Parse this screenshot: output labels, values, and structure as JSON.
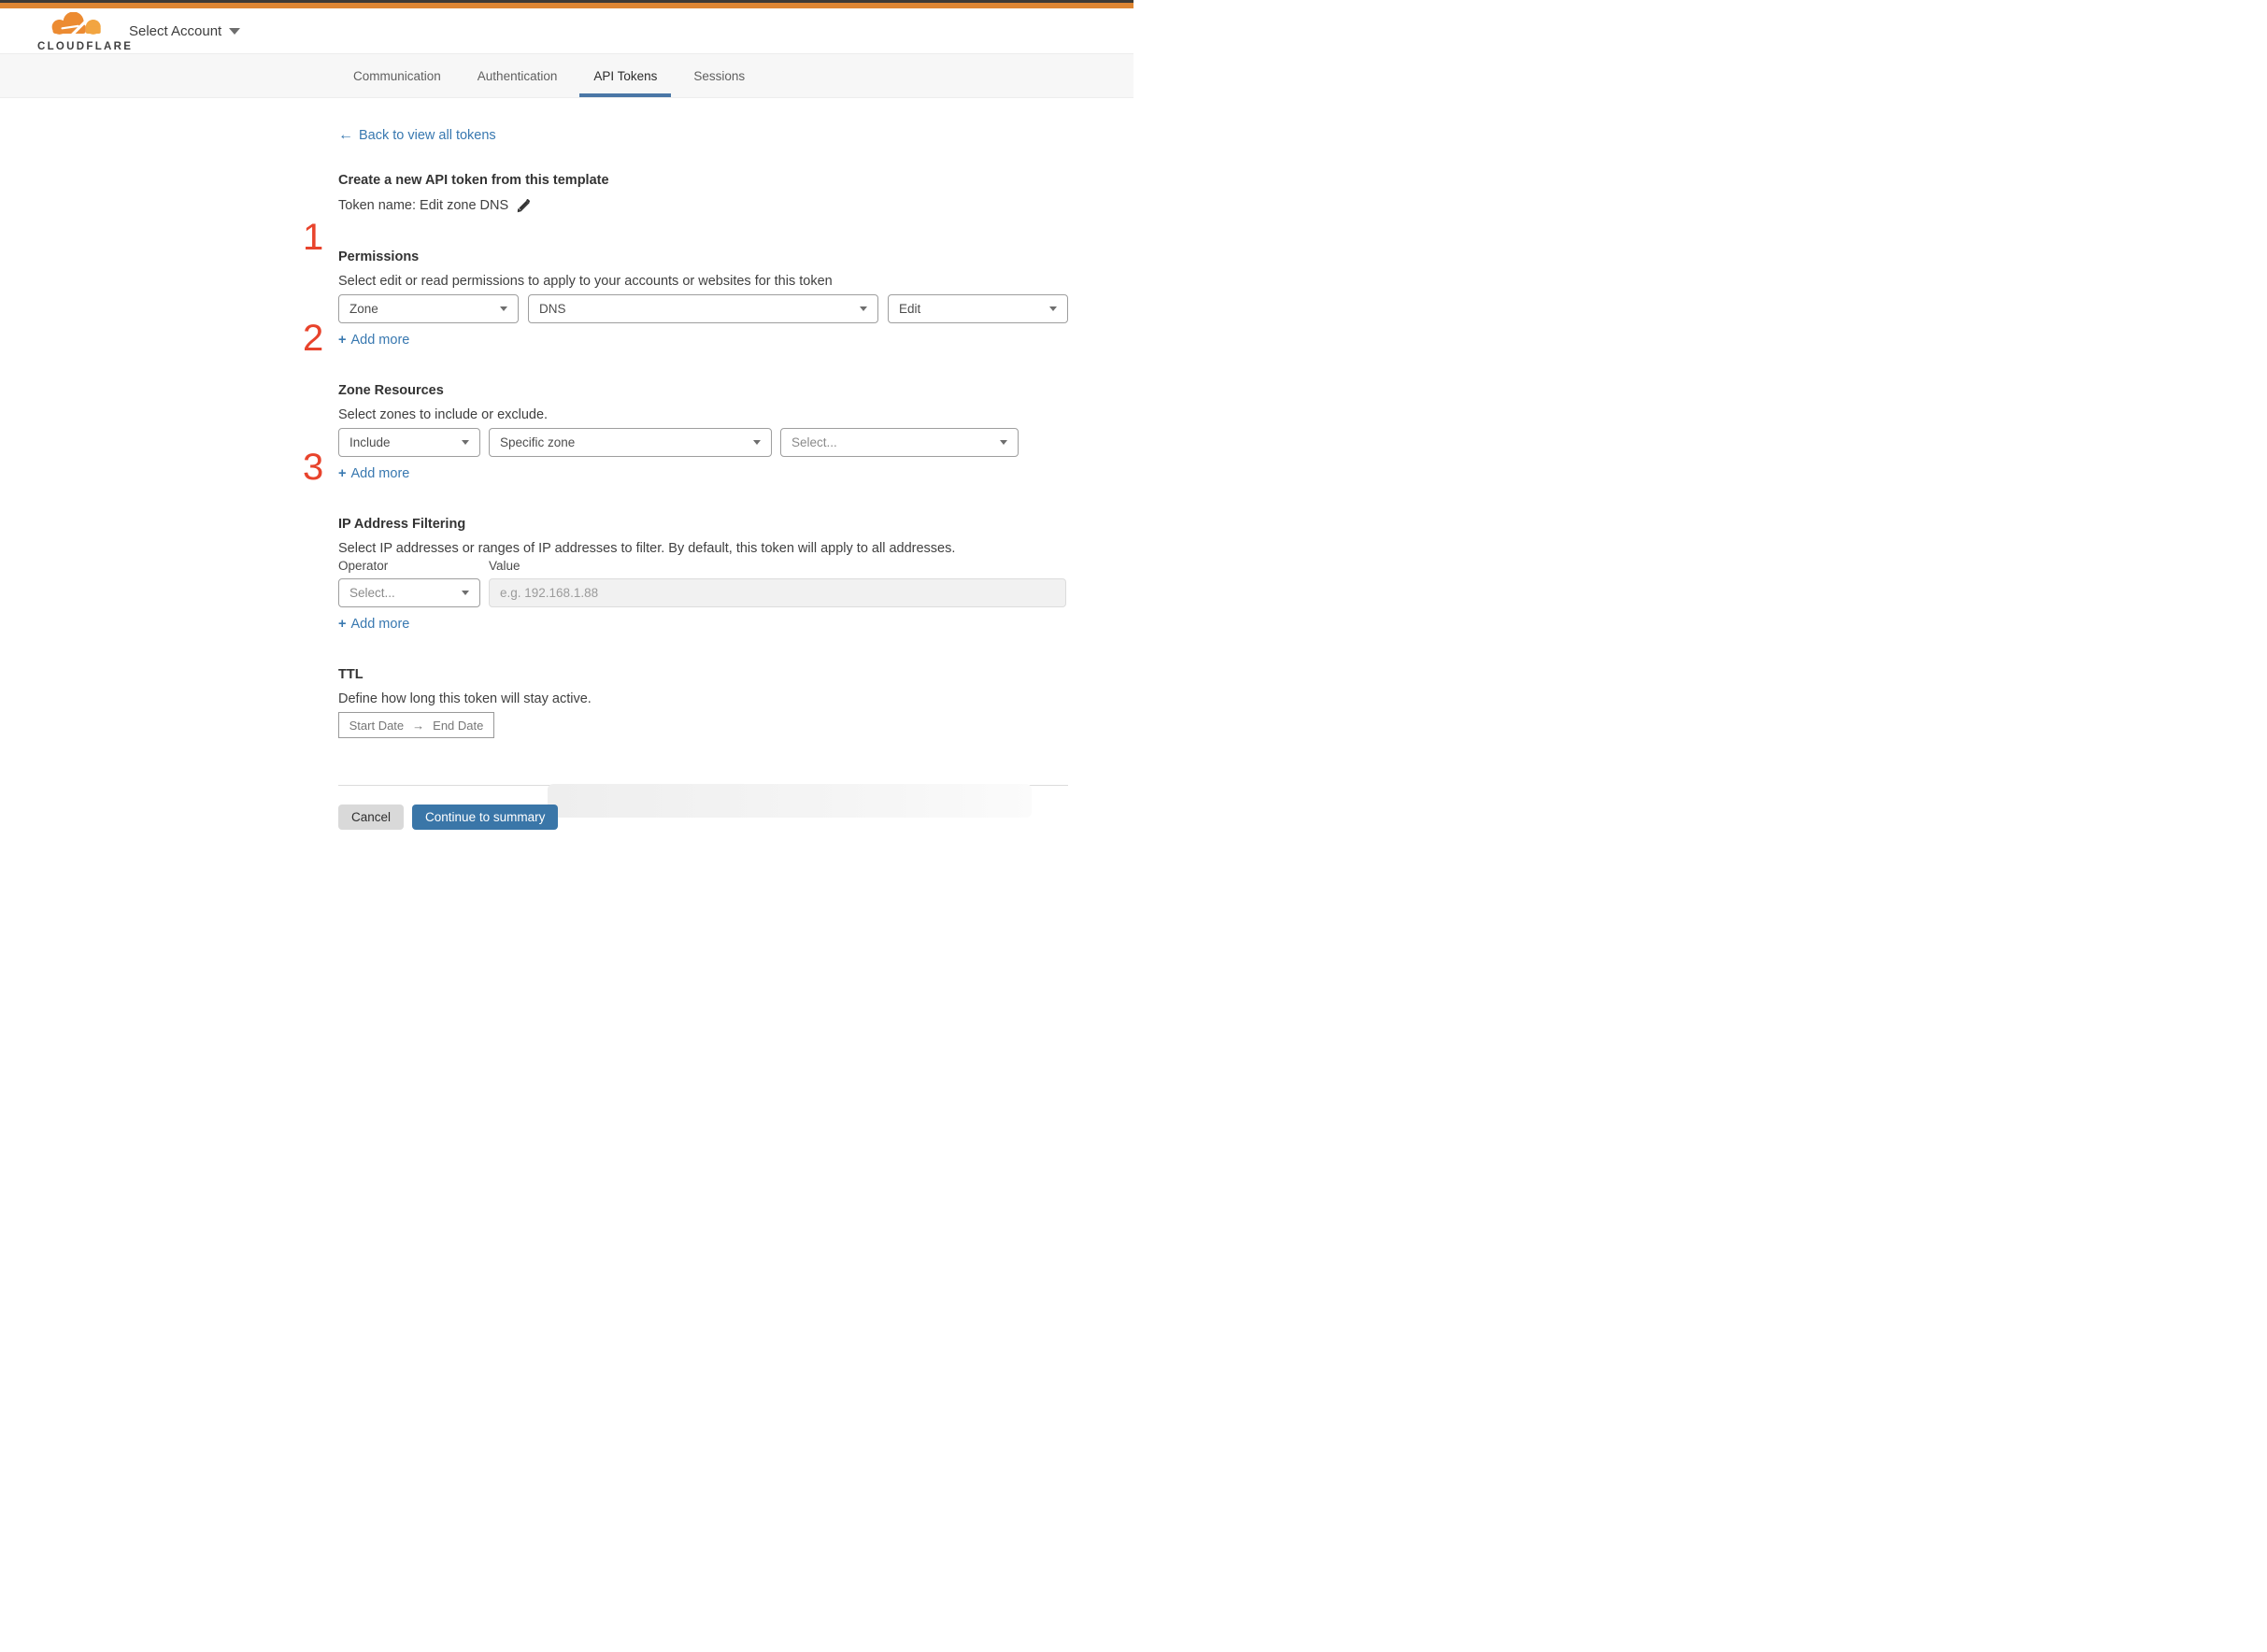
{
  "header": {
    "brand": "CLOUDFLARE",
    "account_selector": "Select Account"
  },
  "tabs": {
    "items": [
      {
        "label": "Communication",
        "active": false
      },
      {
        "label": "Authentication",
        "active": false
      },
      {
        "label": "API Tokens",
        "active": true
      },
      {
        "label": "Sessions",
        "active": false
      }
    ]
  },
  "page": {
    "back_link": {
      "arrow": "←",
      "label": "Back to view all tokens"
    },
    "title": "Create a new API token from this template",
    "token_name": "Token name: Edit zone DNS",
    "annotations": {
      "step1": "1",
      "step2": "2",
      "step3": "3"
    },
    "add_more": {
      "plus": "+",
      "label": "Add more"
    },
    "permissions": {
      "heading": "Permissions",
      "description": "Select edit or read permissions to apply to your accounts or websites for this token",
      "selects": [
        {
          "value": "Zone"
        },
        {
          "value": "DNS"
        },
        {
          "value": "Edit"
        }
      ]
    },
    "zone_resources": {
      "heading": "Zone Resources",
      "description": "Select zones to include or exclude.",
      "selects": [
        {
          "value": "Include"
        },
        {
          "value": "Specific zone"
        },
        {
          "value": "Select..."
        }
      ]
    },
    "ip_filtering": {
      "heading": "IP Address Filtering",
      "description": "Select IP addresses or ranges of IP addresses to filter. By default, this token will apply to all addresses.",
      "operator_label": "Operator",
      "value_label": "Value",
      "operator_value": "Select...",
      "value_placeholder": "e.g. 192.168.1.88"
    },
    "ttl": {
      "heading": "TTL",
      "description": "Define how long this token will stay active.",
      "start_date": "Start Date",
      "arrow": "→",
      "end_date": "End Date"
    },
    "footer": {
      "cancel": "Cancel",
      "continue": "Continue to summary"
    }
  },
  "colors": {
    "topbar_orange": "#de8633",
    "topbar_dark": "#3e3a35",
    "link_blue": "#3878b0",
    "tab_underline_blue": "#4a77a6",
    "continue_button_blue": "#3a76a8",
    "annotation_red": "#e8432c"
  }
}
